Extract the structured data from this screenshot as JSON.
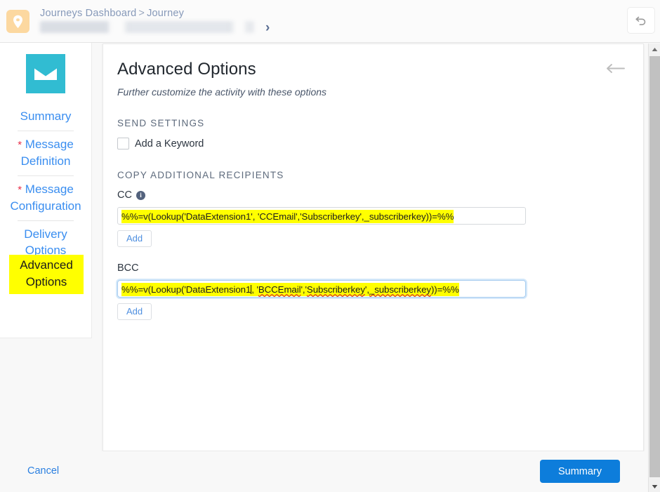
{
  "topbar": {
    "app_icon": "location-pin-icon",
    "breadcrumb": {
      "root": "Journeys Dashboard",
      "separator": ">",
      "current": "Journey",
      "chevron": "›"
    },
    "undo_icon": "undo-arrow-icon"
  },
  "sidebar": {
    "activity_icon": "email-envelope-icon",
    "items": [
      {
        "label": "Summary",
        "required": false
      },
      {
        "label": "Message Definition",
        "required": true,
        "star": "*"
      },
      {
        "label": "Message Configuration",
        "required": true,
        "star": "*"
      },
      {
        "label": "Delivery Options",
        "required": false
      }
    ],
    "active_item": {
      "label": "Advanced Options",
      "highlight_color": "#ffff00"
    }
  },
  "main": {
    "title": "Advanced Options",
    "subtitle": "Further customize the activity with these options",
    "back_icon": "arrow-left-icon",
    "send_settings": {
      "section_label": "SEND SETTINGS",
      "keyword_checkbox_label": "Add a Keyword",
      "keyword_checked": false
    },
    "copy_recipients": {
      "section_label": "COPY ADDITIONAL RECIPIENTS",
      "cc": {
        "label": "CC",
        "info_icon": "info-circle-icon",
        "value": "%%=v(Lookup('DataExtension1', 'CCEmail','Subscriberkey',_subscriberkey))=%%",
        "highlight_color": "#ffff00",
        "add_label": "Add",
        "focused": false
      },
      "bcc": {
        "label": "BCC",
        "value_part1": "%%=v(Lookup('DataExtension1",
        "value_part2": ", '",
        "misspelled1": "BCCEmail",
        "value_part3": "','",
        "misspelled2": "Subscriberkey",
        "value_part4": "',",
        "misspelled3": "_subscriberkey",
        "value_part5": "))=%%",
        "value": "%%=v(Lookup('DataExtension1, 'BCCEmail','Subscriberkey',_subscriberkey))=%%",
        "highlight_color": "#ffff00",
        "add_label": "Add",
        "focused": true
      }
    }
  },
  "footer": {
    "cancel_label": "Cancel",
    "summary_label": "Summary",
    "summary_color": "#0d7ddb"
  },
  "scrollbar": {
    "up_icon": "scroll-up-arrow-icon",
    "down_icon": "scroll-down-arrow-icon"
  }
}
